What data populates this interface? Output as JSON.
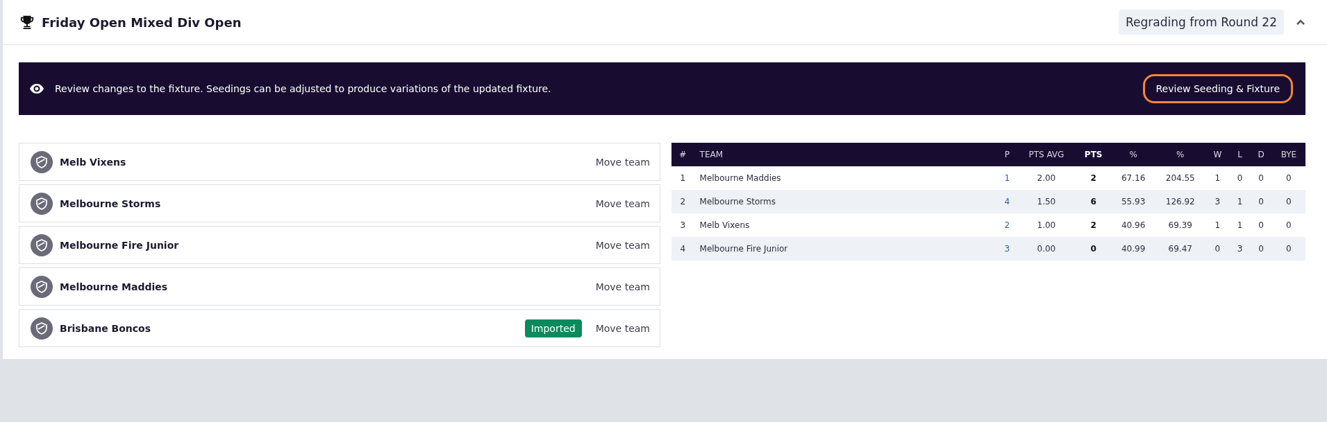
{
  "header": {
    "title": "Friday Open Mixed Div Open",
    "badge": "Regrading from Round 22",
    "expanded": true
  },
  "banner": {
    "message": "Review changes to the fixture. Seedings can be adjusted to produce variations of the updated fixture.",
    "button": "Review Seeding & Fixture"
  },
  "teams": [
    {
      "name": "Melb Vixens",
      "imported": false,
      "action": "Move team"
    },
    {
      "name": "Melbourne Storms",
      "imported": false,
      "action": "Move team"
    },
    {
      "name": "Melbourne Fire Junior",
      "imported": false,
      "action": "Move team"
    },
    {
      "name": "Melbourne Maddies",
      "imported": false,
      "action": "Move team"
    },
    {
      "name": "Brisbane Boncos",
      "imported": true,
      "imported_label": "Imported",
      "action": "Move team"
    }
  ],
  "table": {
    "columns": [
      "#",
      "TEAM",
      "P",
      "PTS AVG",
      "PTS",
      "%",
      "%",
      "W",
      "L",
      "D",
      "BYE"
    ],
    "rows": [
      [
        "1",
        "Melbourne Maddies",
        "1",
        "2.00",
        "2",
        "67.16",
        "204.55",
        "1",
        "0",
        "0",
        "0"
      ],
      [
        "2",
        "Melbourne Storms",
        "4",
        "1.50",
        "6",
        "55.93",
        "126.92",
        "3",
        "1",
        "0",
        "0"
      ],
      [
        "3",
        "Melb Vixens",
        "2",
        "1.00",
        "2",
        "40.96",
        "69.39",
        "1",
        "1",
        "0",
        "0"
      ],
      [
        "4",
        "Melbourne Fire Junior",
        "3",
        "0.00",
        "0",
        "40.99",
        "69.47",
        "0",
        "3",
        "0",
        "0"
      ]
    ]
  }
}
